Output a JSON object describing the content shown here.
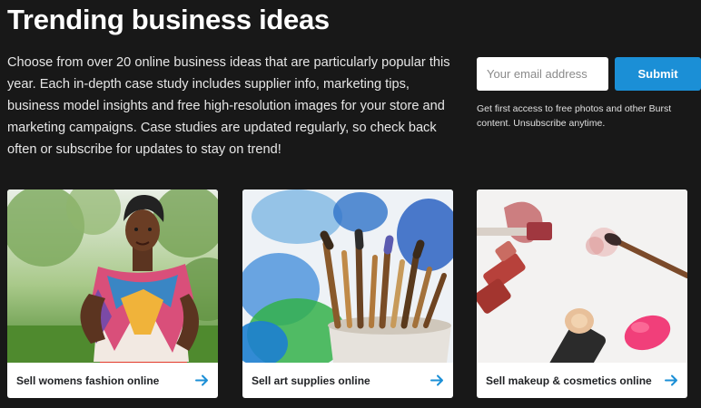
{
  "header": {
    "title": "Trending business ideas",
    "intro": "Choose from over 20 online business ideas that are particularly popular this year. Each in-depth case study includes supplier info, marketing tips, business model insights and free high-resolution images for your store and marketing campaigns. Case studies are updated regularly, so check back often or subscribe for updates to stay on trend!"
  },
  "signup": {
    "placeholder": "Your email address",
    "value": "",
    "submit_label": "Submit",
    "fine_print": "Get first access to free photos and other Burst content. Unsubscribe anytime."
  },
  "cards": [
    {
      "label": "Sell womens fashion online",
      "image": "woman-in-scarf-photo",
      "icon": "arrow-right-icon"
    },
    {
      "label": "Sell art supplies online",
      "image": "paint-brushes-photo",
      "icon": "arrow-right-icon"
    },
    {
      "label": "Sell makeup & cosmetics online",
      "image": "makeup-cosmetics-photo",
      "icon": "arrow-right-icon"
    }
  ],
  "colors": {
    "background": "#181818",
    "accent": "#1b8fd6",
    "arrow": "#1b8fd6",
    "card_text": "#212326"
  }
}
